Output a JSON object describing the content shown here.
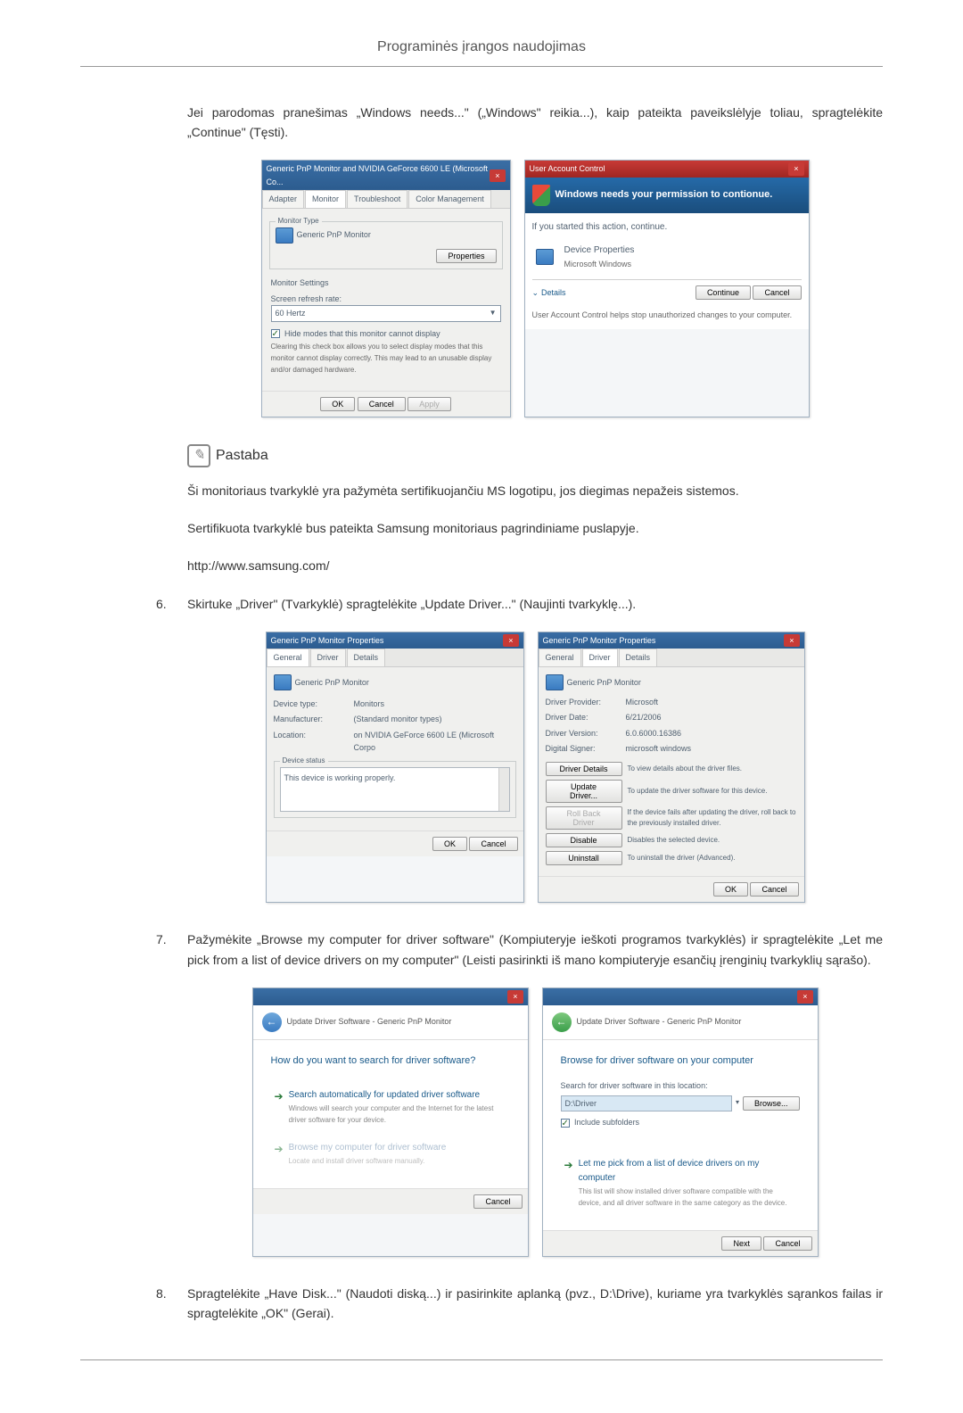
{
  "page_title": "Programinės įrangos naudojimas",
  "intro_text": "Jei parodomas pranešimas „Windows needs...\" („Windows\" reikia...), kaip pateikta paveikslėlyje toliau, spragtelėkite „Continue\" (Tęsti).",
  "screenshot1": {
    "title": "Generic PnP Monitor and NVIDIA GeForce 6600 LE (Microsoft Co...",
    "tabs": [
      "Adapter",
      "Monitor",
      "Troubleshoot",
      "Color Management"
    ],
    "group1_label": "Monitor Type",
    "monitor_name": "Generic PnP Monitor",
    "properties_btn": "Properties",
    "group2_label": "Monitor Settings",
    "refresh_label": "Screen refresh rate:",
    "refresh_value": "60 Hertz",
    "hide_modes": "Hide modes that this monitor cannot display",
    "hide_desc": "Clearing this check box allows you to select display modes that this monitor cannot display correctly. This may lead to an unusable display and/or damaged hardware.",
    "ok": "OK",
    "cancel": "Cancel",
    "apply": "Apply"
  },
  "screenshot2": {
    "title": "User Account Control",
    "banner": "Windows needs your permission to contionue.",
    "if_started": "If you started this action, continue.",
    "device_props": "Device Properties",
    "ms_windows": "Microsoft Windows",
    "details": "Details",
    "footer": "User Account Control helps stop unauthorized changes to your computer.",
    "continue": "Continue",
    "cancel": "Cancel"
  },
  "note_label": "Pastaba",
  "note_text1": "Ši monitoriaus tvarkyklė yra pažymėta sertifikuojančiu MS logotipu, jos diegimas nepažeis sistemos.",
  "note_text2": "Sertifikuota tvarkyklė bus pateikta Samsung monitoriaus pagrindiniame puslapyje.",
  "note_url": "http://www.samsung.com/",
  "step6_num": "6.",
  "step6_text": "Skirtuke „Driver\" (Tvarkyklė) spragtelėkite „Update Driver...\" (Naujinti tvarkyklę...).",
  "screenshot3": {
    "title": "Generic PnP Monitor Properties",
    "tabs": [
      "General",
      "Driver",
      "Details"
    ],
    "monitor_name": "Generic PnP Monitor",
    "device_type_label": "Device type:",
    "device_type": "Monitors",
    "manufacturer_label": "Manufacturer:",
    "manufacturer": "(Standard monitor types)",
    "location_label": "Location:",
    "location": "on NVIDIA GeForce 6600 LE (Microsoft Corpo",
    "status_label": "Device status",
    "status_text": "This device is working properly.",
    "ok": "OK",
    "cancel": "Cancel"
  },
  "screenshot4": {
    "title": "Generic PnP Monitor Properties",
    "tabs": [
      "General",
      "Driver",
      "Details"
    ],
    "monitor_name": "Generic PnP Monitor",
    "provider_label": "Driver Provider:",
    "provider": "Microsoft",
    "date_label": "Driver Date:",
    "date": "6/21/2006",
    "version_label": "Driver Version:",
    "version": "6.0.6000.16386",
    "signer_label": "Digital Signer:",
    "signer": "microsoft windows",
    "btn_details": "Driver Details",
    "desc_details": "To view details about the driver files.",
    "btn_update": "Update Driver...",
    "desc_update": "To update the driver software for this device.",
    "btn_rollback": "Roll Back Driver",
    "desc_rollback": "If the device fails after updating the driver, roll back to the previously installed driver.",
    "btn_disable": "Disable",
    "desc_disable": "Disables the selected device.",
    "btn_uninstall": "Uninstall",
    "desc_uninstall": "To uninstall the driver (Advanced).",
    "ok": "OK",
    "cancel": "Cancel"
  },
  "step7_num": "7.",
  "step7_text": "Pažymėkite „Browse my computer for driver software\" (Kompiuteryje ieškoti programos tvarkyklės) ir spragtelėkite „Let me pick from a list of device drivers on my computer\" (Leisti pasirinkti iš mano kompiuteryje esančių įrenginių tvarkyklių sąrašo).",
  "screenshot5": {
    "breadcrumb": "Update Driver Software - Generic PnP Monitor",
    "heading": "How do you want to search for driver software?",
    "opt1_title": "Search automatically for updated driver software",
    "opt1_sub": "Windows will search your computer and the Internet for the latest driver software for your device.",
    "opt2_title": "Browse my computer for driver software",
    "opt2_sub": "Locate and install driver software manually.",
    "cancel": "Cancel"
  },
  "screenshot6": {
    "breadcrumb": "Update Driver Software - Generic PnP Monitor",
    "heading": "Browse for driver software on your computer",
    "search_label": "Search for driver software in this location:",
    "path_value": "D:\\Driver",
    "browse_btn": "Browse...",
    "include_sub": "Include subfolders",
    "opt_title": "Let me pick from a list of device drivers on my computer",
    "opt_sub": "This list will show installed driver software compatible with the device, and all driver software in the same category as the device.",
    "next": "Next",
    "cancel": "Cancel"
  },
  "step8_num": "8.",
  "step8_text": "Spragtelėkite „Have Disk...\" (Naudoti diską...) ir pasirinkite aplanką (pvz., D:\\Drive), kuriame yra tvarkyklės sąrankos failas ir spragtelėkite „OK\" (Gerai)."
}
